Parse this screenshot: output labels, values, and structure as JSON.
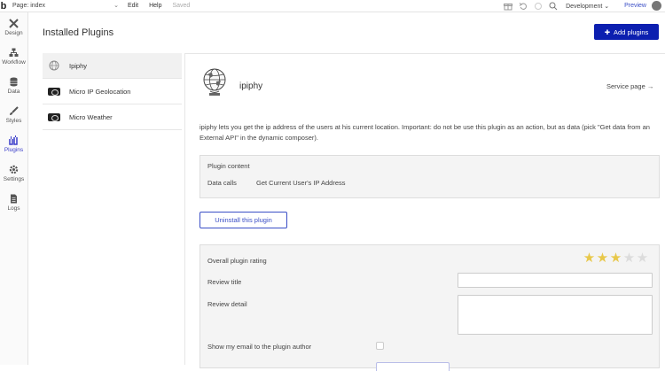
{
  "topbar": {
    "logo": "b",
    "page_label": "Page: index",
    "menu": {
      "edit": "Edit",
      "help": "Help",
      "saved": "Saved"
    },
    "environment": "Development",
    "preview": "Preview"
  },
  "rail": {
    "items": [
      {
        "label": "Design",
        "icon": "design-icon"
      },
      {
        "label": "Workflow",
        "icon": "workflow-icon"
      },
      {
        "label": "Data",
        "icon": "data-icon"
      },
      {
        "label": "Styles",
        "icon": "styles-icon"
      },
      {
        "label": "Plugins",
        "icon": "plugins-icon",
        "active": true
      },
      {
        "label": "Settings",
        "icon": "settings-icon"
      },
      {
        "label": "Logs",
        "icon": "logs-icon"
      }
    ]
  },
  "main": {
    "title": "Installed Plugins",
    "add_button": "Add plugins",
    "plugins": [
      {
        "name": "Ipiphy",
        "selected": true
      },
      {
        "name": "Micro IP Geolocation"
      },
      {
        "name": "Micro Weather"
      }
    ]
  },
  "detail": {
    "name": "ipiphy",
    "service_link": "Service page →",
    "description": "ipiphy lets you get the ip address of the users at his current location. Important: do not be use this plugin as an action, but as data (pick \"Get data from an External API\" in the dynamic composer).",
    "content": {
      "title": "Plugin content",
      "label": "Data calls",
      "value": "Get Current User's IP Address"
    },
    "uninstall": "Uninstall this plugin",
    "review": {
      "rating_label": "Overall plugin rating",
      "rating": 3,
      "rating_max": 5,
      "title_label": "Review title",
      "detail_label": "Review detail",
      "email_label": "Show my email to the plugin author"
    }
  },
  "colors": {
    "accent": "#0c1fb0",
    "link": "#3a4ec6",
    "star": "#e8c84a"
  }
}
